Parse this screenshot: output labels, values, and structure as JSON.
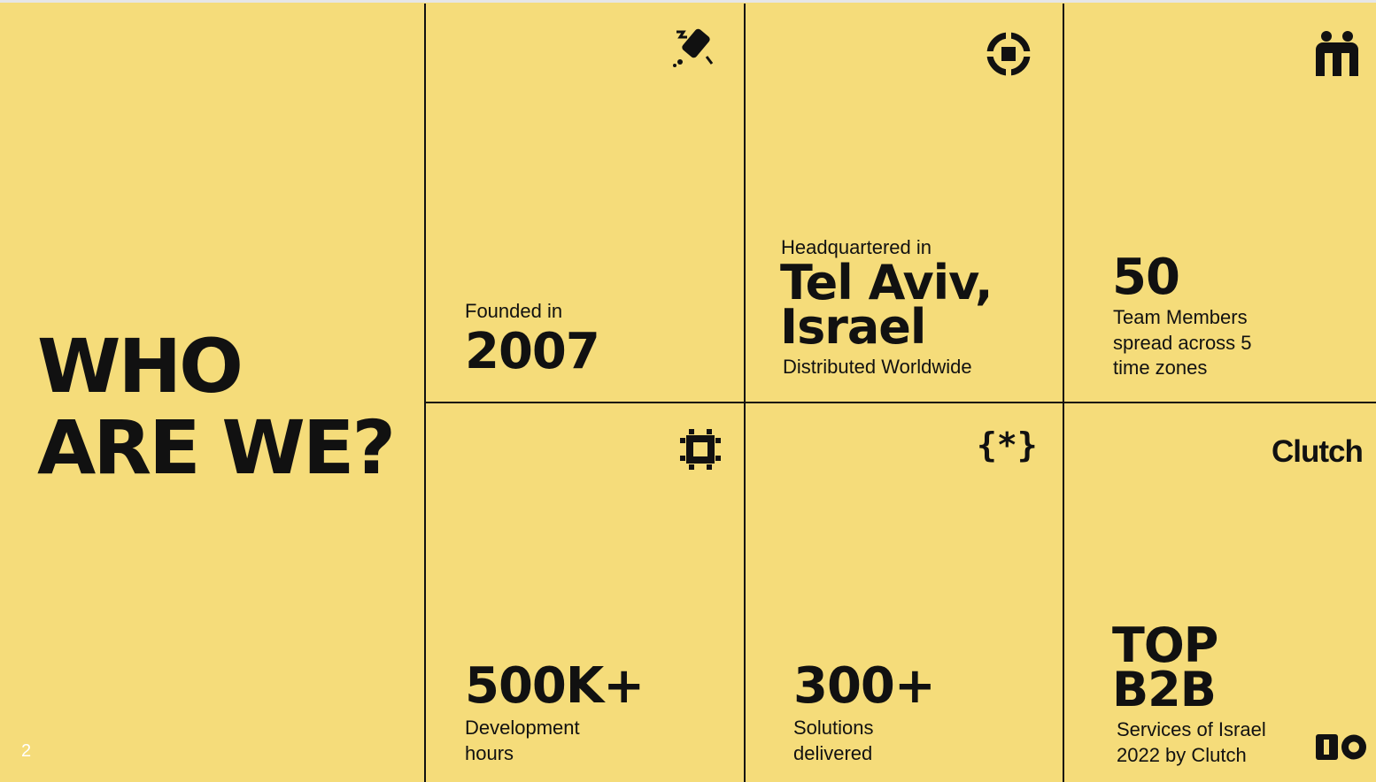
{
  "slide": {
    "title_line1": "WHO",
    "title_line2": "ARE WE?",
    "page_number": "2"
  },
  "cards": {
    "founded": {
      "label": "Founded in",
      "value": "2007",
      "icon": "satellite-icon"
    },
    "hq": {
      "label": "Headquartered in",
      "value_line1": "Tel Aviv,",
      "value_line2": "Israel",
      "sub": "Distributed Worldwide",
      "icon": "target-icon"
    },
    "team": {
      "value": "50",
      "desc_line1": "Team Members",
      "desc_line2": "spread across 5",
      "desc_line3": "time zones",
      "icon": "team-icon"
    },
    "hours": {
      "value": "500K+",
      "desc_line1": "Development",
      "desc_line2": "hours",
      "icon": "chip-icon"
    },
    "solutions": {
      "value": "300+",
      "desc_line1": "Solutions",
      "desc_line2": "delivered",
      "icon": "code-braces-icon"
    },
    "award": {
      "brand": "Clutch",
      "value_line1": "TOP",
      "value_line2": "B2B",
      "desc_line1": "Services of Israel",
      "desc_line2": "2022 by Clutch",
      "icon": "io-logo-icon"
    }
  },
  "colors": {
    "background": "#f5dc7a",
    "ink": "#111111"
  }
}
